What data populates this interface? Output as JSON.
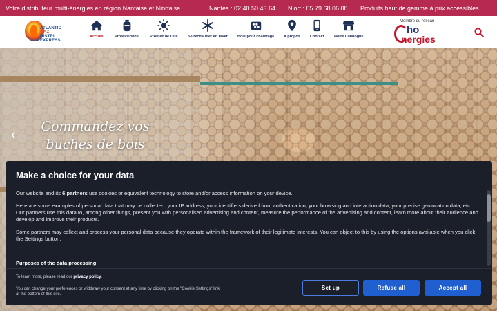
{
  "topbar": {
    "tagline": "Votre distributeur multi-énergies en région Nantaise et Niortaise",
    "phone_nantes": "Nantes : 02 40 50 43 64",
    "phone_niort": "Niort : 05 79 68 06 08",
    "promo": "Produits haut de gamme à prix accessibles",
    "background_color": "#b52a4e"
  },
  "logo": {
    "line1": "ATLANTIC",
    "line2": "GAZ",
    "line3": "DISTRI",
    "line4": "EXPRESS"
  },
  "nav": {
    "items": [
      {
        "label": "Accueil",
        "icon": "home-icon",
        "active": true
      },
      {
        "label": "Professionnel",
        "icon": "gas-bottle-icon",
        "active": false
      },
      {
        "label": "Profitez de l'été",
        "icon": "sun-icon",
        "active": false
      },
      {
        "label": "Se réchauffer en hiver",
        "icon": "snowflake-icon",
        "active": false
      },
      {
        "label": "Bois pour chauffage",
        "icon": "firewood-icon",
        "active": false
      },
      {
        "label": "A propos",
        "icon": "map-pin-icon",
        "active": false
      },
      {
        "label": "Contact",
        "icon": "phone-icon",
        "active": false
      },
      {
        "label": "Notre Catalogue",
        "icon": "shop-icon",
        "active": false
      }
    ],
    "active_color": "#c4182f"
  },
  "partner": {
    "caption": "Membre du réseau",
    "brand_top": "ho",
    "brand_bottom": "nergies"
  },
  "hero": {
    "title": "Commandez vos buches de bois"
  },
  "cookie": {
    "title": "Make a choice for your data",
    "p1_prefix": "Our website and its",
    "p1_link": "6 partners",
    "p1_suffix": "use cookies or equivalent technology to store and/or access information on your device.",
    "p2": "Here are some examples of personal data that may be collected: your IP address, your identifiers derived from authentication, your browsing and interaction data, your precise geolocation data, etc.",
    "p3": "Our partners use this data to, among other things, present you with personalised advertising and content, measure the performance of the advertising and content, learn more about their audience and develop and improve their products.",
    "p4": "Some partners may collect and process your personal data because they operate within the framework of their legitimate interests. You can object to this by using the options available when you click the Settings button.",
    "purposes_heading": "Purposes of the data processing",
    "learn_prefix": "To learn more, please read our",
    "privacy_link": "privacy policy.",
    "change_note": "You can change your preferences or widthraw your consent at any time by clicking on the \"Cookie Settings\" link at the bottom of this site.",
    "setup_label": "Set up",
    "refuse_label": "Refuse all",
    "accept_label": "Accept all",
    "button_color": "#1f5fcf"
  }
}
